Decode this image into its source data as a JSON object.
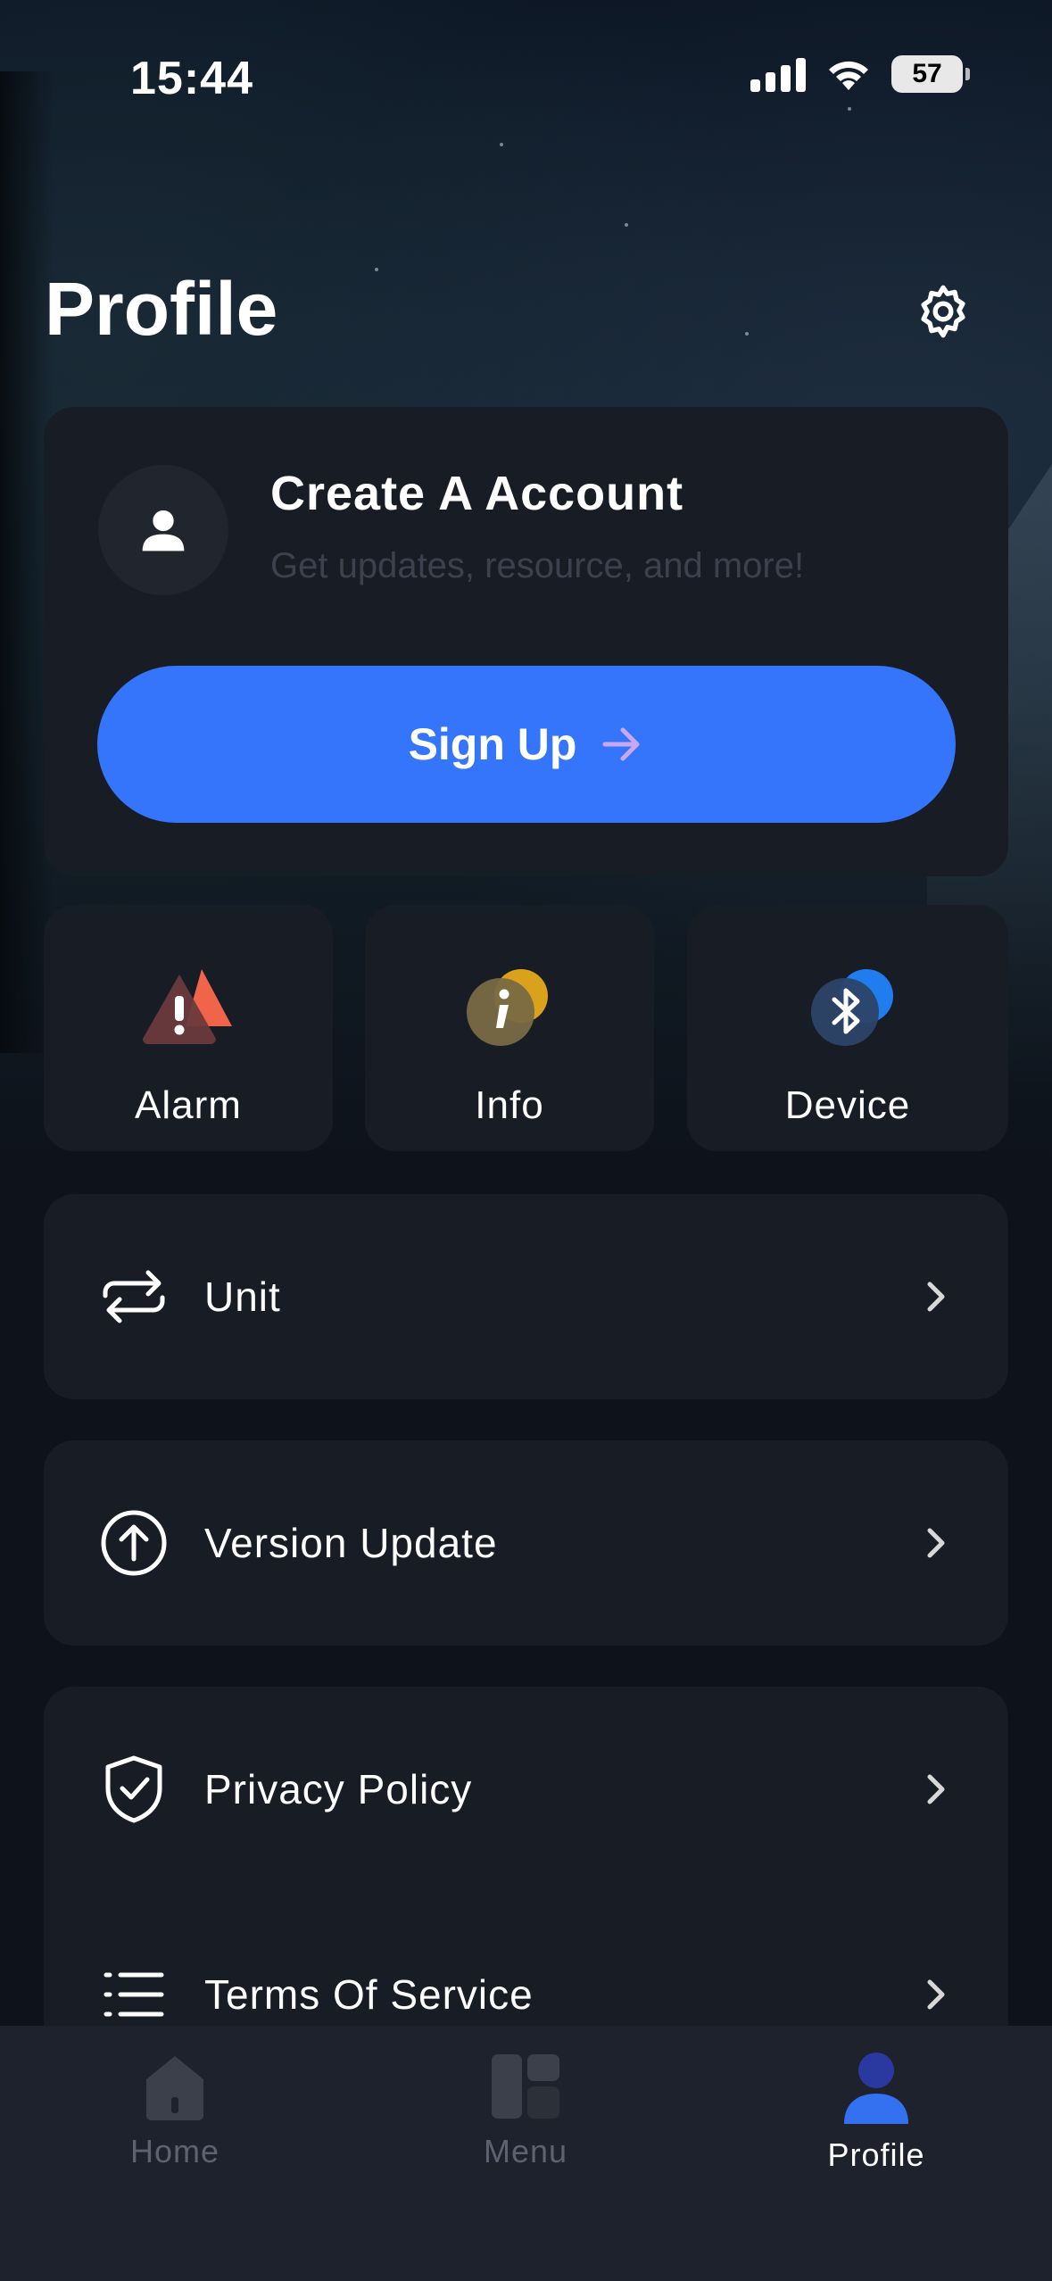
{
  "status_bar": {
    "time": "15:44",
    "battery": "57"
  },
  "header": {
    "title": "Profile"
  },
  "account": {
    "title": "Create A Account",
    "subtitle": "Get updates, resource, and more!",
    "signup_label": "Sign Up"
  },
  "tiles": [
    {
      "label": "Alarm",
      "icon": "alarm-warning-icon"
    },
    {
      "label": "Info",
      "icon": "info-icon"
    },
    {
      "label": "Device",
      "icon": "bluetooth-icon"
    }
  ],
  "menu": [
    {
      "label": "Unit",
      "icon": "swap-arrows-icon"
    },
    {
      "label": "Version Update",
      "icon": "arrow-up-circle-icon"
    },
    {
      "label": "Privacy Policy",
      "icon": "shield-check-icon"
    },
    {
      "label": "Terms Of Service",
      "icon": "list-icon"
    }
  ],
  "tabbar": {
    "items": [
      {
        "label": "Home",
        "icon": "home-icon",
        "active": false
      },
      {
        "label": "Menu",
        "icon": "grid-icon",
        "active": false
      },
      {
        "label": "Profile",
        "icon": "person-icon",
        "active": true
      }
    ]
  },
  "colors": {
    "accent": "#3575fb",
    "card": "#181c25",
    "background": "#0e131b",
    "tabbar": "#1e222c",
    "muted_text": "#3c424d"
  }
}
